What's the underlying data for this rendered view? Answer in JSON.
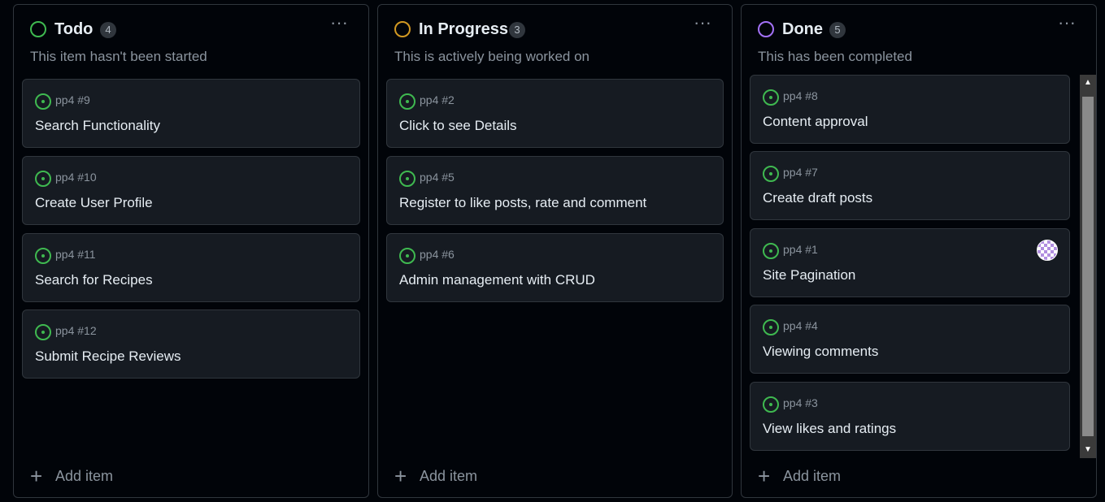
{
  "columns": [
    {
      "title": "Todo",
      "count": "4",
      "description": "This item hasn't been started",
      "status_color": "#3fb950",
      "menu_label": "···",
      "add_item_label": "Add item",
      "cards": [
        {
          "ref": "pp4 #9",
          "title": "Search Functionality"
        },
        {
          "ref": "pp4 #10",
          "title": "Create User Profile"
        },
        {
          "ref": "pp4 #11",
          "title": "Search for Recipes"
        },
        {
          "ref": "pp4 #12",
          "title": "Submit Recipe Reviews"
        }
      ]
    },
    {
      "title": "In Progress",
      "count": "3",
      "description": "This is actively being worked on",
      "status_color": "#d29922",
      "menu_label": "···",
      "add_item_label": "Add item",
      "cards": [
        {
          "ref": "pp4 #2",
          "title": "Click to see Details"
        },
        {
          "ref": "pp4 #5",
          "title": "Register to like posts, rate and comment"
        },
        {
          "ref": "pp4 #6",
          "title": "Admin management with CRUD"
        }
      ]
    },
    {
      "title": "Done",
      "count": "5",
      "description": "This has been completed",
      "status_color": "#a371f7",
      "menu_label": "···",
      "add_item_label": "Add item",
      "cards": [
        {
          "ref": "pp4 #8",
          "title": "Content approval"
        },
        {
          "ref": "pp4 #7",
          "title": "Create draft posts"
        },
        {
          "ref": "pp4 #1",
          "title": "Site Pagination",
          "has_avatar": true
        },
        {
          "ref": "pp4 #4",
          "title": "Viewing comments"
        },
        {
          "ref": "pp4 #3",
          "title": "View likes and ratings"
        }
      ]
    }
  ],
  "icons": {
    "status": "circle-icon",
    "issue": "issue-open-icon",
    "menu": "kebab-horizontal-icon",
    "add": "plus-icon",
    "scroll_up": "arrow-up-icon",
    "scroll_down": "arrow-down-icon"
  },
  "colors": {
    "issue_open": "#3fb950",
    "card_bg": "#161b22",
    "page_bg": "#010409"
  }
}
